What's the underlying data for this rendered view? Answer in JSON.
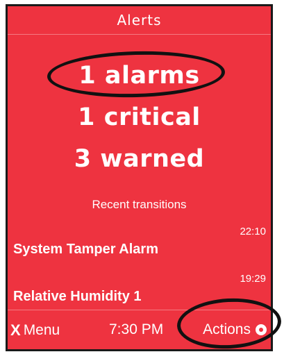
{
  "header": {
    "title": "Alerts"
  },
  "stats": {
    "alarms": "1 alarms",
    "critical": "1 critical",
    "warned": "3 warned"
  },
  "recent": {
    "heading": "Recent transitions",
    "items": [
      {
        "name": "System Tamper Alarm",
        "time": "22:10"
      },
      {
        "name": "Relative Humidity 1",
        "time": "19:29"
      }
    ]
  },
  "footer": {
    "menu_icon": "X",
    "menu_label": "Menu",
    "time": "7:30 PM",
    "actions_label": "Actions",
    "actions_icon": "select-dot-icon"
  },
  "colors": {
    "background": "#ee3340",
    "text": "#ffffff",
    "annotation": "#111111"
  }
}
